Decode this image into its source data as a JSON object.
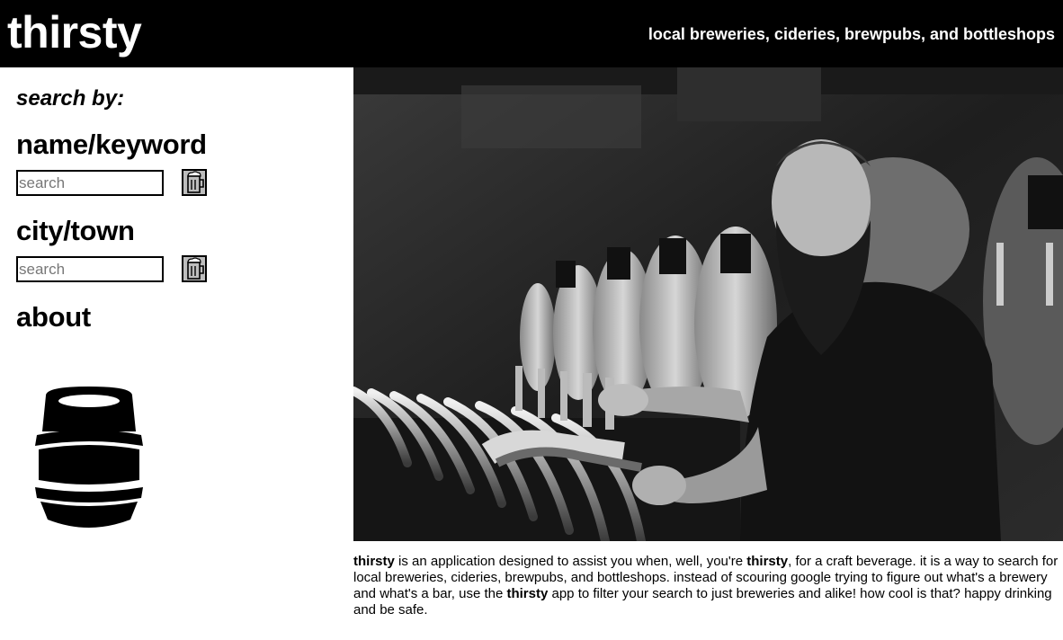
{
  "header": {
    "brand": "thirsty",
    "tagline": "local breweries, cideries, brewpubs, and bottleshops"
  },
  "sidebar": {
    "search_by_label": "search by:",
    "name_keyword": {
      "heading": "name/keyword",
      "placeholder": "search",
      "button_icon": "beer-mug-icon"
    },
    "city_town": {
      "heading": "city/town",
      "placeholder": "search",
      "button_icon": "beer-mug-icon"
    },
    "about_link": "about",
    "logo_icon": "keg-icon"
  },
  "about": {
    "p1": "thirsty",
    "p2": " is an application designed to assist you when, well, you're ",
    "p3": "thirsty",
    "p4": ", for a craft beverage. it is a way to search for local breweries, cideries, brewpubs, and bottleshops. instead of scouring google trying to figure out what's a brewery and what's a bar, use the ",
    "p5": "thirsty",
    "p6": " app to filter your search to just breweries and alike! how cool is that? happy drinking and be safe."
  },
  "colors": {
    "header_bg": "#000000",
    "header_text": "#ffffff",
    "button_bg": "#bdbdbd"
  }
}
